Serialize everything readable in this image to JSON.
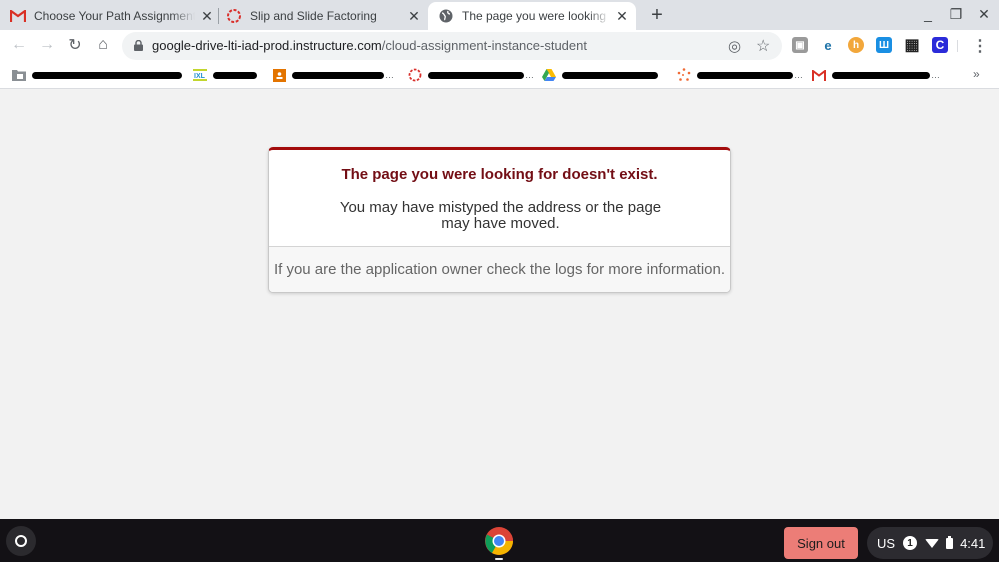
{
  "browser": {
    "tabs": [
      {
        "title": "Choose Your Path Assignment - ",
        "favicon": "gmail-icon",
        "active": false
      },
      {
        "title": "Slip and Slide Factoring",
        "favicon": "instructure-icon",
        "active": false
      },
      {
        "title": "The page you were looking for doesn't exist",
        "favicon": "globe-icon",
        "active": true
      }
    ],
    "new_tab_label": "+",
    "window_controls": {
      "minimize": "_",
      "restore": "❐",
      "close": "✕"
    },
    "tab_close_glyph": "✕",
    "url": {
      "host": "google-drive-lti-iad-prod.instructure.com",
      "path": "/cloud-assignment-instance-student"
    },
    "nav": {
      "back": "←",
      "forward": "→",
      "reload": "↻",
      "home": "⌂"
    },
    "omnibox_icons": {
      "location": "◎",
      "star": "☆"
    },
    "extensions": [
      {
        "name": "copies-extension-icon",
        "glyph": "▣",
        "color": "#8a8a8a"
      },
      {
        "name": "edge-extension-icon",
        "glyph": "e",
        "color": "#1e73a8"
      },
      {
        "name": "honey-extension-icon",
        "glyph": "h",
        "color": "#f2a73b"
      },
      {
        "name": "ui-extension-icon",
        "glyph": "Ш",
        "color": "#1a8fe3"
      },
      {
        "name": "qr-extension-icon",
        "glyph": "▦",
        "color": "#222222"
      },
      {
        "name": "c-extension-icon",
        "glyph": "C",
        "color": "#2b2bd9"
      }
    ],
    "menu_glyph": "⋮",
    "bookmarks": [
      {
        "icon": "folder-icon",
        "redacted": true
      },
      {
        "icon": "ixl-icon",
        "redacted": true
      },
      {
        "icon": "classroom-icon",
        "redacted": true
      },
      {
        "icon": "instructure-icon",
        "redacted": true
      },
      {
        "icon": "google-drive-icon",
        "redacted": true
      },
      {
        "icon": "mindtap-icon",
        "redacted": true
      },
      {
        "icon": "gmail-icon",
        "redacted": true
      }
    ],
    "bookmarks_overflow": "»"
  },
  "page": {
    "error_title": "The page you were looking for doesn't exist.",
    "error_message": "You may have mistyped the address or the page may have moved.",
    "footer_message": "If you are the application owner check the logs for more information.",
    "accent_color": "#a30c0c"
  },
  "shelf": {
    "sign_out_label": "Sign out",
    "keyboard_layout": "US",
    "notification_count": "1",
    "time": "4:41"
  }
}
